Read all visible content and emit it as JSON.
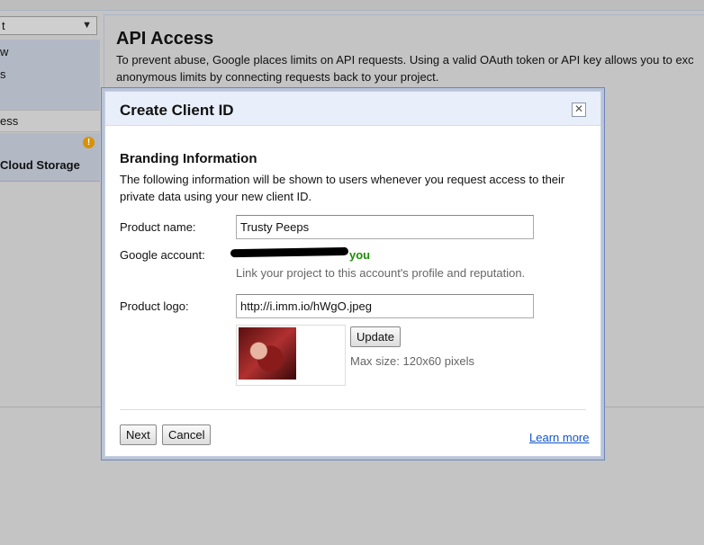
{
  "sidebar": {
    "project_select": "t",
    "items": [
      {
        "label": "w"
      },
      {
        "label": "s"
      },
      {
        "label": "ess"
      },
      {
        "label": "Cloud Storage"
      }
    ]
  },
  "main": {
    "title": "API Access",
    "description_line1": "To prevent abuse, Google places limits on API requests. Using a valid OAuth token or API key allows you to exc",
    "description_line2": "anonymous limits by connecting requests back to your project."
  },
  "modal": {
    "title": "Create Client ID",
    "close_glyph": "✕",
    "section_title": "Branding Information",
    "section_desc": "The following information will be shown to users whenever you request access to their private data using your new client ID.",
    "product_name_label": "Product name:",
    "product_name_value": "Trusty Peeps",
    "google_account_label": "Google account:",
    "google_account_suffix": "you",
    "google_account_hint": "Link your project to this account's profile and reputation.",
    "product_logo_label": "Product logo:",
    "product_logo_value": "http://i.imm.io/hWgO.jpeg",
    "update_label": "Update",
    "max_size": "Max size: 120x60 pixels",
    "next_label": "Next",
    "cancel_label": "Cancel",
    "learn_more": "Learn more"
  },
  "colors": {
    "accent_link": "#1155cc",
    "account_green": "#1a8f00",
    "warning": "#d99100"
  }
}
